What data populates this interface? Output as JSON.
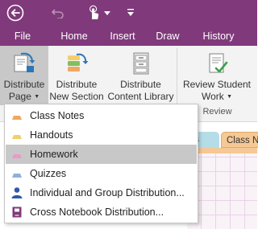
{
  "quick_access": {
    "back_icon": "back-arrow-icon",
    "undo_icon": "undo-icon",
    "touch_icon": "touch-mode-icon",
    "customize_icon": "chevron-down-icon",
    "more_icon": "more-icon"
  },
  "tabs": [
    "File",
    "Home",
    "Insert",
    "Draw",
    "History"
  ],
  "ribbon": {
    "distribute_page": {
      "line1": "Distribute",
      "line2": "Page"
    },
    "distribute_section": {
      "line1": "Distribute",
      "line2": "New Section"
    },
    "distribute_library": {
      "line1": "Distribute",
      "line2": "Content Library"
    },
    "review_work": {
      "line1": "Review Student",
      "line2": "Work"
    },
    "review_group_label": "Review"
  },
  "notebook": {
    "tab_partial": "ts",
    "tab_class": "Class N"
  },
  "menu": {
    "items": [
      {
        "label": "Class Notes",
        "icon": "section-tab-icon",
        "color": "#f0a860"
      },
      {
        "label": "Handouts",
        "icon": "section-tab-icon",
        "color": "#f3cf6a"
      },
      {
        "label": "Homework",
        "icon": "section-tab-icon",
        "color": "#e89ac8",
        "highlighted": true
      },
      {
        "label": "Quizzes",
        "icon": "section-tab-icon",
        "color": "#8fb0d8"
      },
      {
        "label": "Individual and Group Distribution...",
        "icon": "person-icon",
        "color": "#2e5aa8"
      },
      {
        "label": "Cross Notebook Distribution...",
        "icon": "notebook-icon",
        "color": "#80397b"
      }
    ]
  },
  "colors": {
    "accent": "#80397b",
    "ribbon_bg": "#f3f3f3",
    "highlight": "#c8c8c8"
  }
}
